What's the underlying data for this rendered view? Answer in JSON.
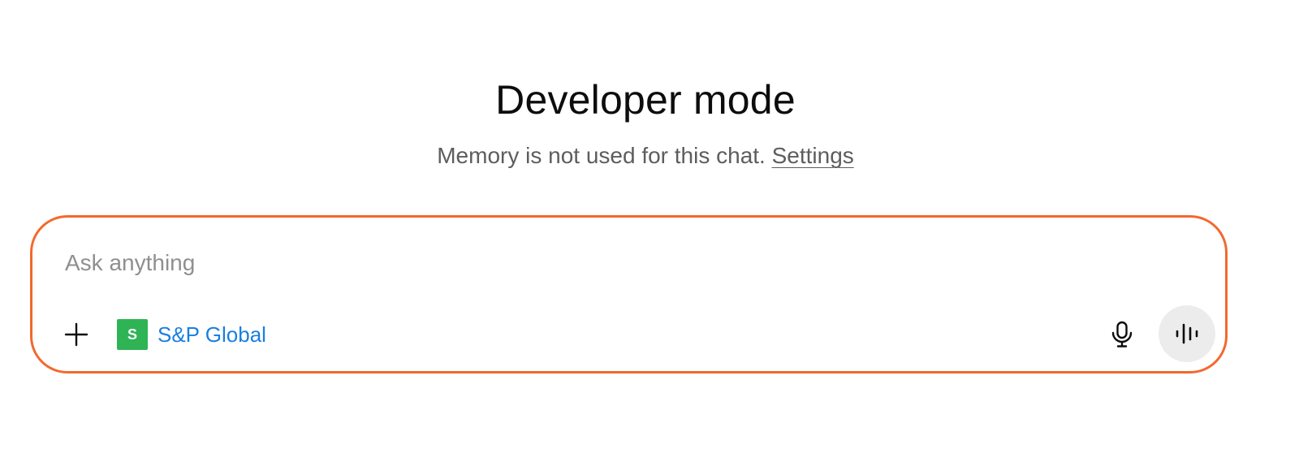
{
  "header": {
    "title": "Developer mode",
    "subtitle_text": "Memory is not used for this chat. ",
    "settings_link": "Settings"
  },
  "composer": {
    "placeholder": "Ask anything",
    "value": "",
    "connector": {
      "logo_letter": "S",
      "label": "S&P Global",
      "logo_color": "#2fb455",
      "label_color": "#1a7fe0"
    },
    "icons": {
      "add": "plus-icon",
      "dictate": "microphone-icon",
      "voice": "voice-waveform-icon"
    },
    "border_color": "#f2692e"
  }
}
